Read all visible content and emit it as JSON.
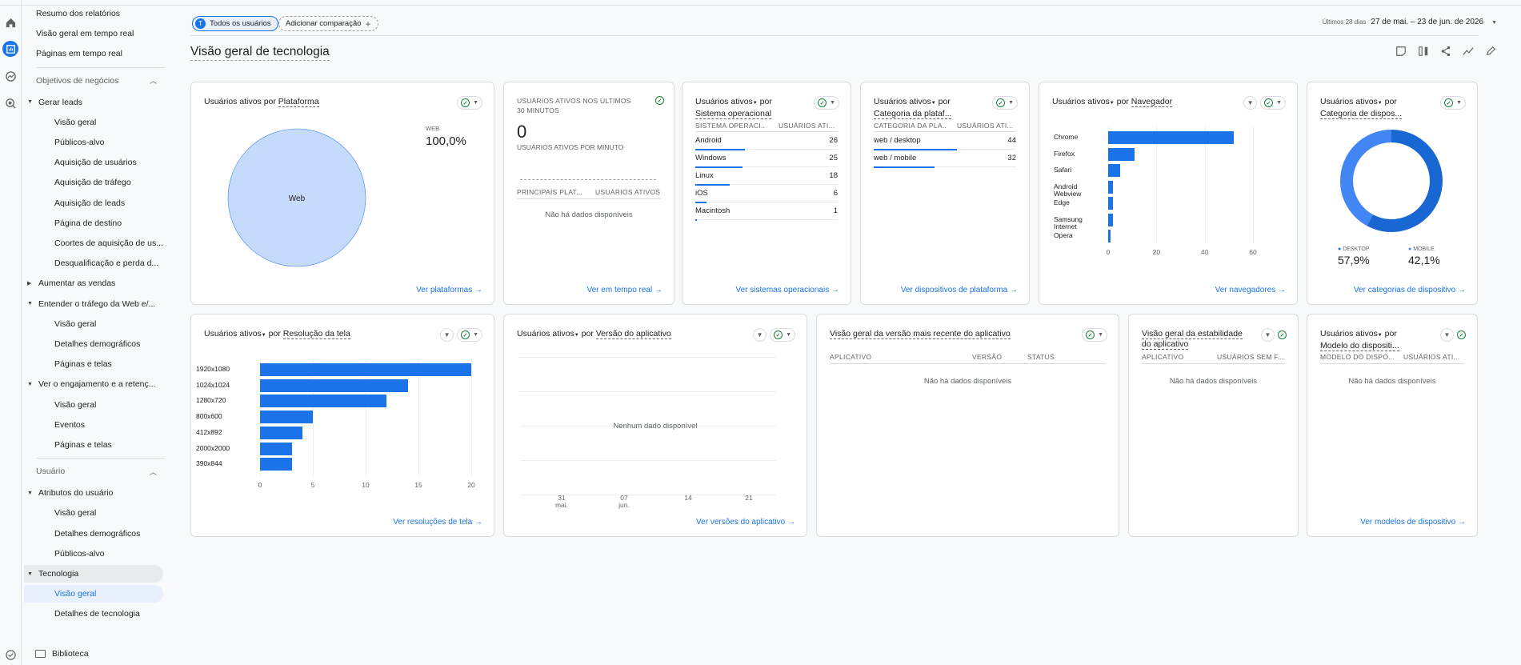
{
  "nav": {
    "items": [
      {
        "label": "Resumo dos relatórios",
        "type": "top"
      },
      {
        "label": "Visão geral em tempo real",
        "type": "top"
      },
      {
        "label": "Páginas em tempo real",
        "type": "top"
      },
      {
        "label": "Objetivos de negócios",
        "type": "section"
      },
      {
        "label": "Gerar leads",
        "type": "group"
      },
      {
        "label": "Visão geral",
        "type": "sub"
      },
      {
        "label": "Públicos-alvo",
        "type": "sub"
      },
      {
        "label": "Aquisição de usuários",
        "type": "sub"
      },
      {
        "label": "Aquisição de tráfego",
        "type": "sub"
      },
      {
        "label": "Aquisição de leads",
        "type": "sub"
      },
      {
        "label": "Página de destino",
        "type": "sub"
      },
      {
        "label": "Coortes de aquisição de us...",
        "type": "sub"
      },
      {
        "label": "Desqualificação e perda d...",
        "type": "sub"
      },
      {
        "label": "Aumentar as vendas",
        "type": "group-closed"
      },
      {
        "label": "Entender o tráfego da Web e/...",
        "type": "group"
      },
      {
        "label": "Visão geral",
        "type": "sub"
      },
      {
        "label": "Detalhes demográficos",
        "type": "sub"
      },
      {
        "label": "Páginas e telas",
        "type": "sub"
      },
      {
        "label": "Ver o engajamento e a retenç...",
        "type": "group"
      },
      {
        "label": "Visão geral",
        "type": "sub"
      },
      {
        "label": "Eventos",
        "type": "sub"
      },
      {
        "label": "Páginas e telas",
        "type": "sub"
      },
      {
        "label": "Usuário",
        "type": "section"
      },
      {
        "label": "Atributos do usuário",
        "type": "group"
      },
      {
        "label": "Visão geral",
        "type": "sub"
      },
      {
        "label": "Detalhes demográficos",
        "type": "sub"
      },
      {
        "label": "Públicos-alvo",
        "type": "sub"
      },
      {
        "label": "Tecnologia",
        "type": "group-hl"
      },
      {
        "label": "Visão geral",
        "type": "sub-sel"
      },
      {
        "label": "Detalhes de tecnologia",
        "type": "sub"
      }
    ],
    "library": "Biblioteca"
  },
  "header": {
    "chip_all": "Todos os usuários",
    "chip_all_avatar": "T",
    "chip_add": "Adicionar comparação",
    "date_small": "Últimos 28 dias",
    "date_range": "27 de mai. – 23 de jun. de 2026",
    "title": "Visão geral de tecnologia"
  },
  "colors": {
    "accent": "#1a73e8",
    "ok": "#188038",
    "pie": "#c6dafc",
    "donut_a": "#4285f4",
    "donut_b": "#1967d2"
  },
  "cards": {
    "platform": {
      "t1": "Usuários ativos por ",
      "t2": "Plataforma",
      "metric_label": "WEB",
      "metric_value": "100,0%",
      "slice_label": "Web",
      "link": "Ver plataformas"
    },
    "realtime": {
      "title": "USUÁRIOS ATIVOS NOS ÚLTIMOS 30 MINUTOS",
      "value": "0",
      "sub": "USUÁRIOS ATIVOS POR MINUTO",
      "col1": "PRINCIPAIS PLAT...",
      "col2": "USUÁRIOS ATIVOS",
      "nodata": "Não há dados disponíveis",
      "link": "Ver em tempo real"
    },
    "os": {
      "t1": "Usuários ativos",
      "t2": " por",
      "t3": "Sistema operacional",
      "col1": "SISTEMA OPERACI...",
      "col2": "USUÁRIOS ATI...",
      "rows": [
        {
          "n": "Android",
          "v": "26"
        },
        {
          "n": "Windows",
          "v": "25"
        },
        {
          "n": "Linux",
          "v": "18"
        },
        {
          "n": "iOS",
          "v": "6"
        },
        {
          "n": "Macintosh",
          "v": "1"
        }
      ],
      "link": "Ver sistemas operacionais"
    },
    "platcat": {
      "t1": "Usuários ativos",
      "t2": " por",
      "t3": "Categoria da plataf...",
      "col1": "CATEGORIA DA PLA...",
      "col2": "USUÁRIOS ATI...",
      "rows": [
        {
          "n": "web / desktop",
          "v": "44"
        },
        {
          "n": "web / mobile",
          "v": "32"
        }
      ],
      "link": "Ver dispositivos de plataforma"
    },
    "browser": {
      "t1": "Usuários ativos",
      "t2": " por ",
      "t3": "Navegador",
      "link": "Ver navegadores"
    },
    "devcat": {
      "t1": "Usuários ativos",
      "t2": " por",
      "t3": "Categoria de dispos...",
      "l1": "DESKTOP",
      "v1": "57,9%",
      "l2": "MOBILE",
      "v2": "42,1%",
      "link": "Ver categorias de dispositivo"
    },
    "screen": {
      "t1": "Usuários ativos",
      "t2": " por ",
      "t3": "Resolução da tela",
      "link": "Ver resoluções de tela"
    },
    "appver": {
      "t1": "Usuários ativos",
      "t2": " por ",
      "t3": "Versão do aplicativo",
      "nodata": "Nenhum dado disponível",
      "link": "Ver versões do aplicativo"
    },
    "latest": {
      "title": "Visão geral da versão mais recente do aplicativo",
      "col1": "APLICATIVO",
      "col2": "VERSÃO",
      "col3": "STATUS",
      "nodata": "Não há dados disponíveis"
    },
    "stability": {
      "title": "Visão geral da estabilidade do aplicativo",
      "col1": "APLICATIVO",
      "col2": "USUÁRIOS SEM F...",
      "nodata": "Não há dados disponíveis"
    },
    "model": {
      "t1": "Usuários ativos",
      "t2": " por",
      "t3": "Modelo do dispositi...",
      "col1": "MODELO DO DISPO...",
      "col2": "USUÁRIOS ATI...",
      "nodata": "Não há dados disponíveis",
      "link": "Ver modelos de dispositivo"
    }
  },
  "chart_data": [
    {
      "type": "pie",
      "categories": [
        "Web"
      ],
      "values": [
        100
      ]
    },
    {
      "type": "bar",
      "orientation": "horizontal",
      "categories": [
        "Chrome",
        "Firefox",
        "Safari",
        "Android Webview",
        "Edge",
        "Samsung Internet",
        "Opera"
      ],
      "values": [
        52,
        11,
        5,
        2,
        2,
        2,
        1
      ],
      "xticks": [
        "0",
        "20",
        "40",
        "60"
      ],
      "xlim": [
        0,
        60
      ]
    },
    {
      "type": "pie",
      "donut": true,
      "categories": [
        "DESKTOP",
        "MOBILE"
      ],
      "values": [
        57.9,
        42.1
      ]
    },
    {
      "type": "bar",
      "orientation": "horizontal",
      "categories": [
        "1920x1080",
        "1024x1024",
        "1280x720",
        "800x600",
        "412x892",
        "2000x2000",
        "390x844"
      ],
      "values": [
        20,
        14,
        12,
        5,
        4,
        3,
        3
      ],
      "xticks": [
        "0",
        "5",
        "10",
        "15",
        "20"
      ],
      "xlim": [
        0,
        20
      ]
    },
    {
      "type": "line",
      "x": [
        "31 mai.",
        "07 jun.",
        "14",
        "21"
      ],
      "values": []
    }
  ]
}
